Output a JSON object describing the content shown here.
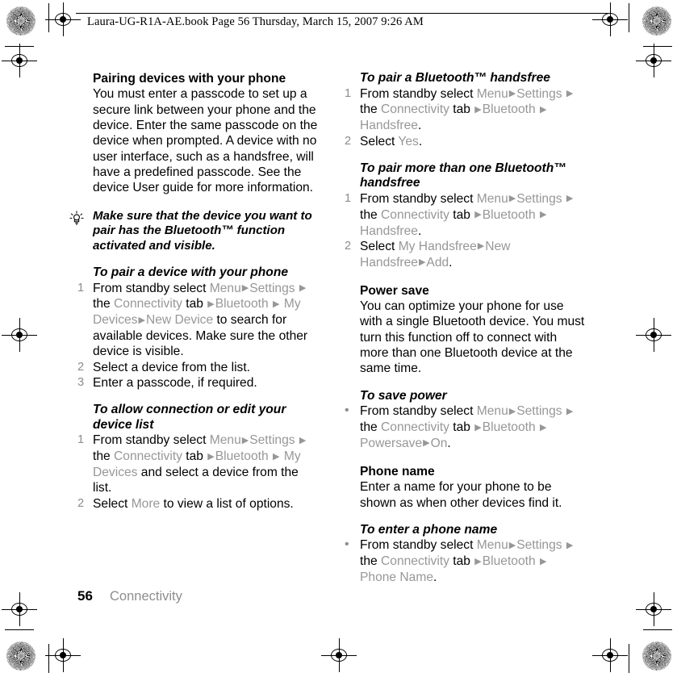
{
  "header": {
    "filename_line": "Laura-UG-R1A-AE.book  Page 56  Thursday, March 15, 2007  9:26 AM"
  },
  "footer": {
    "page_number": "56",
    "running_head": "Connectivity"
  },
  "arrow_glyph": "▶",
  "bullet_glyph": "•",
  "left_column": {
    "section_heading": "Pairing devices with your phone",
    "section_body": "You must enter a passcode to set up a secure link between your phone and the device. Enter the same passcode on the device when prompted. A device with no user interface, such as a handsfree, will have a predefined passcode. See the device User guide for more information.",
    "tip": {
      "icon": "lightbulb-icon",
      "text": "Make sure that the device you want to pair has the Bluetooth™ function activated and visible."
    },
    "procedure_1": {
      "heading": "To pair a device with your phone",
      "steps": [
        {
          "number": "1",
          "parts": [
            {
              "t": "From standby select ",
              "s": "plain"
            },
            {
              "t": "Menu",
              "s": "ui"
            },
            {
              "t": "▶",
              "s": "arrow"
            },
            {
              "t": "Settings",
              "s": "ui"
            },
            {
              "t": " ",
              "s": "plain"
            },
            {
              "t": "▶",
              "s": "arrow"
            },
            {
              "t": " the ",
              "s": "plain"
            },
            {
              "t": "Connectivity",
              "s": "ui"
            },
            {
              "t": " tab ",
              "s": "plain"
            },
            {
              "t": "▶",
              "s": "arrow"
            },
            {
              "t": "Bluetooth",
              "s": "ui"
            },
            {
              "t": " ",
              "s": "plain"
            },
            {
              "t": "▶",
              "s": "arrow"
            },
            {
              "t": " ",
              "s": "plain"
            },
            {
              "t": "My Devices",
              "s": "ui"
            },
            {
              "t": "▶",
              "s": "arrow"
            },
            {
              "t": "New Device",
              "s": "ui"
            },
            {
              "t": " to search for available devices. Make sure the other device is visible.",
              "s": "plain"
            }
          ]
        },
        {
          "number": "2",
          "parts": [
            {
              "t": "Select a device from the list.",
              "s": "plain"
            }
          ]
        },
        {
          "number": "3",
          "parts": [
            {
              "t": "Enter a passcode, if required.",
              "s": "plain"
            }
          ]
        }
      ]
    },
    "procedure_2": {
      "heading": "To allow connection or edit your device list",
      "steps": [
        {
          "number": "1",
          "parts": [
            {
              "t": "From standby select ",
              "s": "plain"
            },
            {
              "t": "Menu",
              "s": "ui"
            },
            {
              "t": "▶",
              "s": "arrow"
            },
            {
              "t": "Settings",
              "s": "ui"
            },
            {
              "t": " ",
              "s": "plain"
            },
            {
              "t": "▶",
              "s": "arrow"
            },
            {
              "t": " the ",
              "s": "plain"
            },
            {
              "t": "Connectivity",
              "s": "ui"
            },
            {
              "t": " tab ",
              "s": "plain"
            },
            {
              "t": "▶",
              "s": "arrow"
            },
            {
              "t": "Bluetooth",
              "s": "ui"
            },
            {
              "t": " ",
              "s": "plain"
            },
            {
              "t": "▶",
              "s": "arrow"
            },
            {
              "t": " ",
              "s": "plain"
            },
            {
              "t": "My Devices",
              "s": "ui"
            },
            {
              "t": " and select a device from the list.",
              "s": "plain"
            }
          ]
        },
        {
          "number": "2",
          "parts": [
            {
              "t": "Select ",
              "s": "plain"
            },
            {
              "t": "More",
              "s": "ui"
            },
            {
              "t": " to view a list of options.",
              "s": "plain"
            }
          ]
        }
      ]
    }
  },
  "right_column": {
    "procedure_1": {
      "heading": "To pair a Bluetooth™ handsfree",
      "steps": [
        {
          "number": "1",
          "parts": [
            {
              "t": "From standby select ",
              "s": "plain"
            },
            {
              "t": "Menu",
              "s": "ui"
            },
            {
              "t": "▶",
              "s": "arrow"
            },
            {
              "t": "Settings",
              "s": "ui"
            },
            {
              "t": " ",
              "s": "plain"
            },
            {
              "t": "▶",
              "s": "arrow"
            },
            {
              "t": " the ",
              "s": "plain"
            },
            {
              "t": "Connectivity",
              "s": "ui"
            },
            {
              "t": " tab ",
              "s": "plain"
            },
            {
              "t": "▶",
              "s": "arrow"
            },
            {
              "t": "Bluetooth",
              "s": "ui"
            },
            {
              "t": " ",
              "s": "plain"
            },
            {
              "t": "▶",
              "s": "arrow"
            },
            {
              "t": " ",
              "s": "plain"
            },
            {
              "t": "Handsfree",
              "s": "ui"
            },
            {
              "t": ".",
              "s": "plain"
            }
          ]
        },
        {
          "number": "2",
          "parts": [
            {
              "t": "Select ",
              "s": "plain"
            },
            {
              "t": "Yes",
              "s": "ui"
            },
            {
              "t": ".",
              "s": "plain"
            }
          ]
        }
      ]
    },
    "procedure_2": {
      "heading": "To pair more than one Bluetooth™ handsfree",
      "steps": [
        {
          "number": "1",
          "parts": [
            {
              "t": "From standby select ",
              "s": "plain"
            },
            {
              "t": "Menu",
              "s": "ui"
            },
            {
              "t": "▶",
              "s": "arrow"
            },
            {
              "t": "Settings",
              "s": "ui"
            },
            {
              "t": " ",
              "s": "plain"
            },
            {
              "t": "▶",
              "s": "arrow"
            },
            {
              "t": " the ",
              "s": "plain"
            },
            {
              "t": "Connectivity",
              "s": "ui"
            },
            {
              "t": " tab ",
              "s": "plain"
            },
            {
              "t": "▶",
              "s": "arrow"
            },
            {
              "t": "Bluetooth",
              "s": "ui"
            },
            {
              "t": " ",
              "s": "plain"
            },
            {
              "t": "▶",
              "s": "arrow"
            },
            {
              "t": " ",
              "s": "plain"
            },
            {
              "t": "Handsfree",
              "s": "ui"
            },
            {
              "t": ".",
              "s": "plain"
            }
          ]
        },
        {
          "number": "2",
          "parts": [
            {
              "t": "Select ",
              "s": "plain"
            },
            {
              "t": "My Handsfree",
              "s": "ui"
            },
            {
              "t": "▶",
              "s": "arrow"
            },
            {
              "t": "New Handsfree",
              "s": "ui"
            },
            {
              "t": "▶",
              "s": "arrow"
            },
            {
              "t": "Add",
              "s": "ui"
            },
            {
              "t": ".",
              "s": "plain"
            }
          ]
        }
      ]
    },
    "section_power_save": {
      "heading": "Power save",
      "body": "You can optimize your phone for use with a single Bluetooth device. You must turn this function off to connect with more than one Bluetooth device at the same time."
    },
    "procedure_3": {
      "heading": "To save power",
      "steps": [
        {
          "number": "•",
          "parts": [
            {
              "t": "From standby select ",
              "s": "plain"
            },
            {
              "t": "Menu",
              "s": "ui"
            },
            {
              "t": "▶",
              "s": "arrow"
            },
            {
              "t": "Settings",
              "s": "ui"
            },
            {
              "t": " ",
              "s": "plain"
            },
            {
              "t": "▶",
              "s": "arrow"
            },
            {
              "t": " the ",
              "s": "plain"
            },
            {
              "t": "Connectivity",
              "s": "ui"
            },
            {
              "t": " tab ",
              "s": "plain"
            },
            {
              "t": "▶",
              "s": "arrow"
            },
            {
              "t": "Bluetooth",
              "s": "ui"
            },
            {
              "t": " ",
              "s": "plain"
            },
            {
              "t": "▶",
              "s": "arrow"
            },
            {
              "t": " ",
              "s": "plain"
            },
            {
              "t": "Powersave",
              "s": "ui"
            },
            {
              "t": "▶",
              "s": "arrow"
            },
            {
              "t": "On",
              "s": "ui"
            },
            {
              "t": ".",
              "s": "plain"
            }
          ]
        }
      ]
    },
    "section_phone_name": {
      "heading": "Phone name",
      "body": "Enter a name for your phone to be shown as when other devices find it."
    },
    "procedure_4": {
      "heading": "To enter a phone name",
      "steps": [
        {
          "number": "•",
          "parts": [
            {
              "t": "From standby select ",
              "s": "plain"
            },
            {
              "t": "Menu",
              "s": "ui"
            },
            {
              "t": "▶",
              "s": "arrow"
            },
            {
              "t": "Settings",
              "s": "ui"
            },
            {
              "t": " ",
              "s": "plain"
            },
            {
              "t": "▶",
              "s": "arrow"
            },
            {
              "t": " the ",
              "s": "plain"
            },
            {
              "t": "Connectivity",
              "s": "ui"
            },
            {
              "t": " tab ",
              "s": "plain"
            },
            {
              "t": "▶",
              "s": "arrow"
            },
            {
              "t": "Bluetooth",
              "s": "ui"
            },
            {
              "t": " ",
              "s": "plain"
            },
            {
              "t": "▶",
              "s": "arrow"
            },
            {
              "t": " ",
              "s": "plain"
            },
            {
              "t": "Phone Name",
              "s": "ui"
            },
            {
              "t": ".",
              "s": "plain"
            }
          ]
        }
      ]
    }
  },
  "colors": {
    "ui_gray": "#979797",
    "running_head_gray": "#8d8d8d",
    "text_black": "#000000"
  }
}
